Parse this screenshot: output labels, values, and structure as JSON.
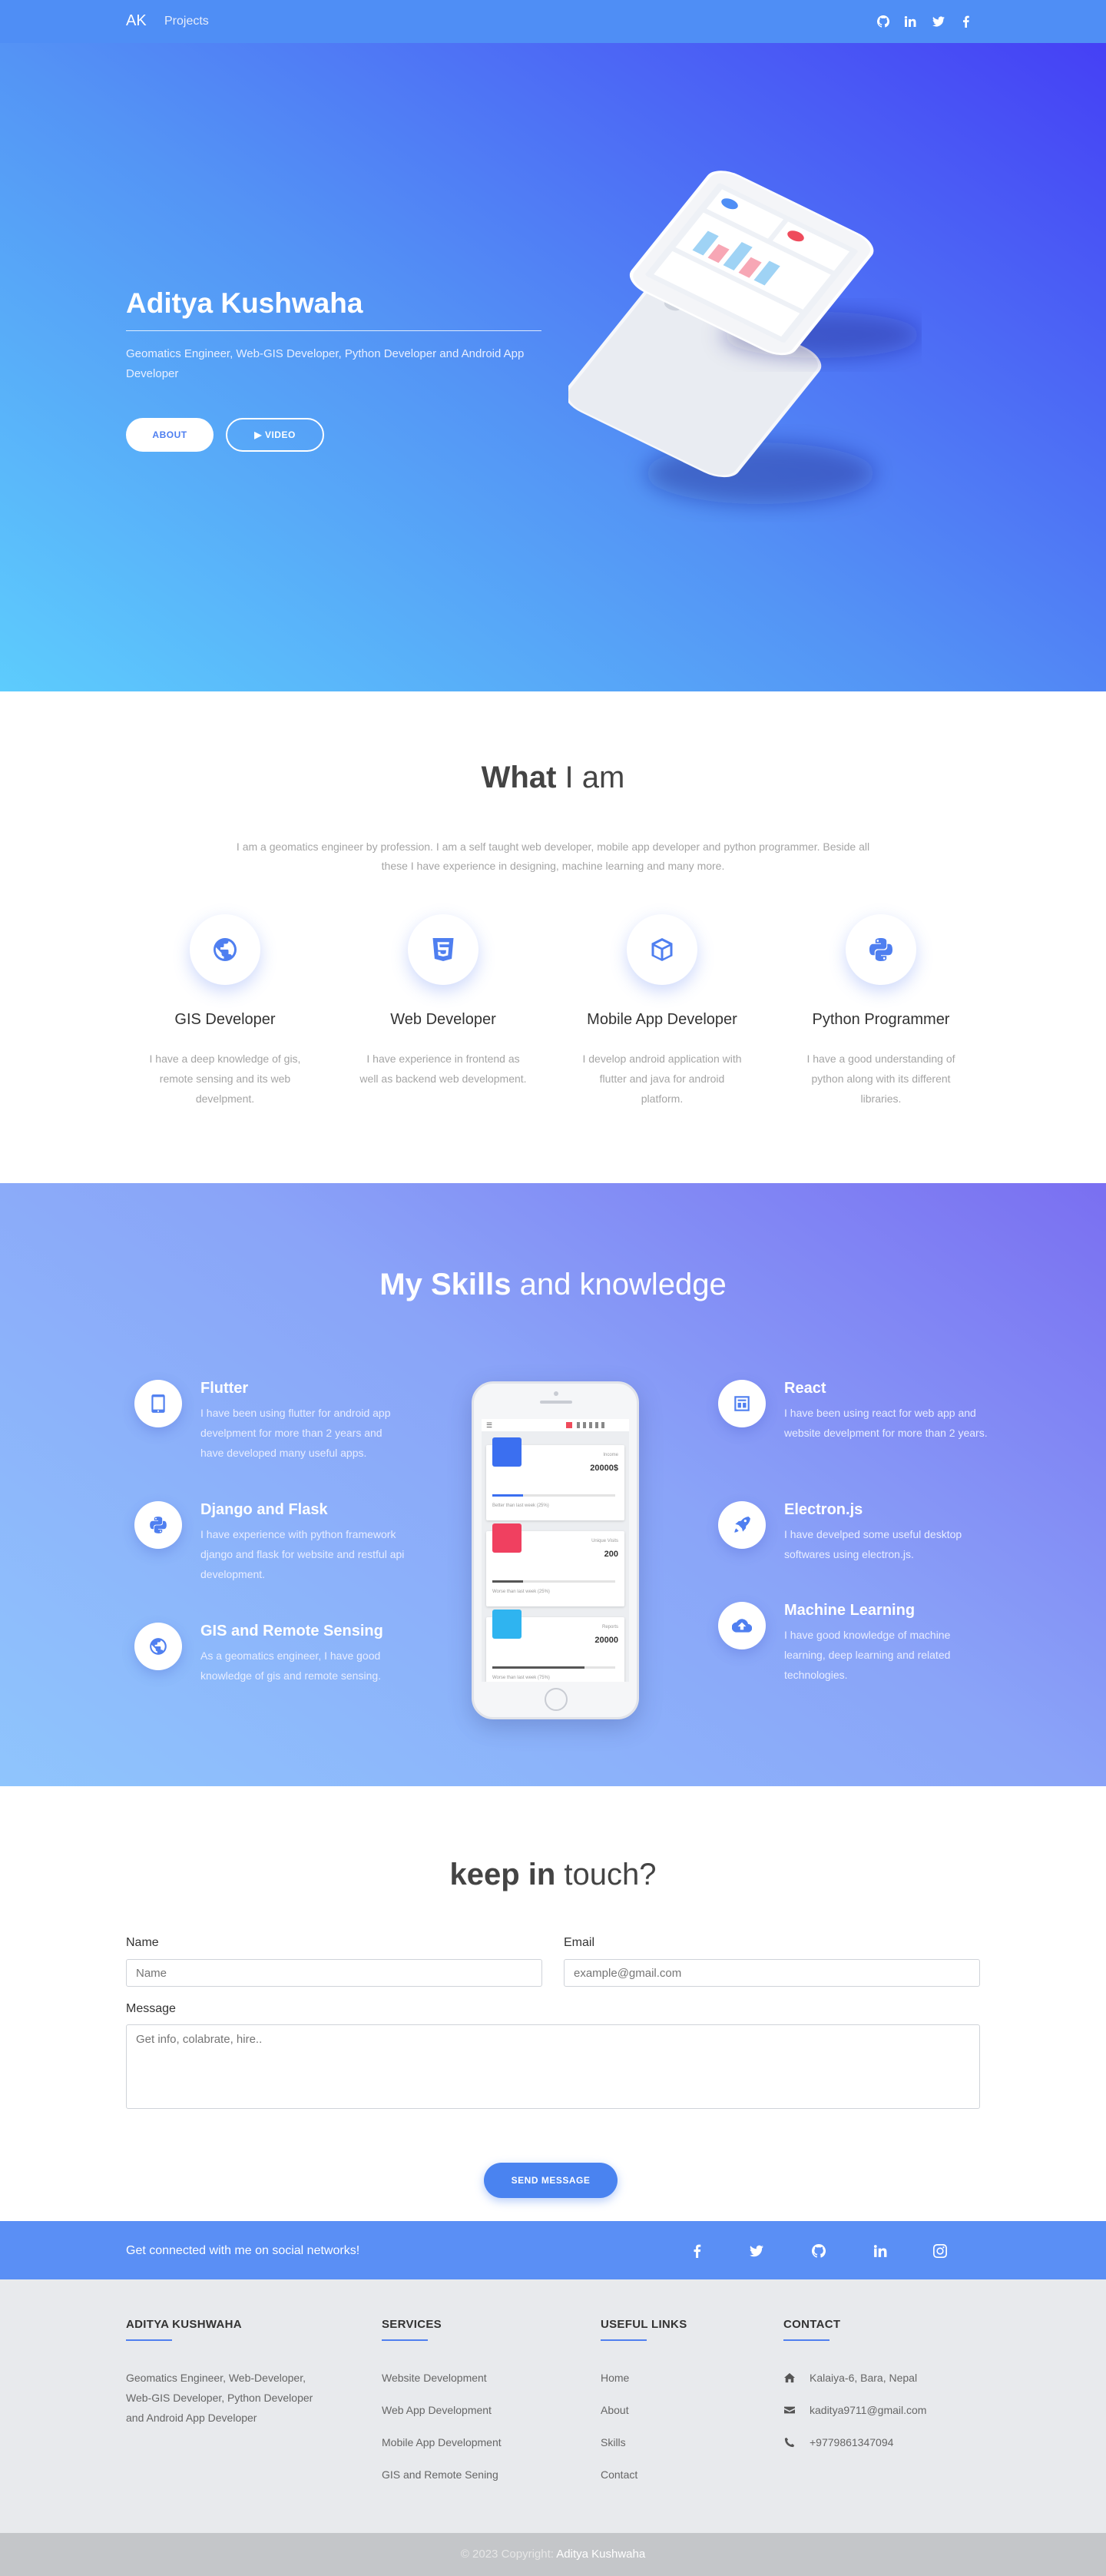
{
  "navbar": {
    "brand": "AK",
    "projects": "Projects"
  },
  "hero": {
    "title": "Aditya Kushwaha",
    "subtitle": "Geomatics Engineer, Web-GIS Developer, Python Developer and Android App Developer",
    "about_btn": "ABOUT",
    "video_btn": "VIDEO"
  },
  "what": {
    "title_bold": "What",
    "title_rest": " I am",
    "description": "I am a geomatics engineer by profession. I am a self taught web developer, mobile app developer and python programmer. Beside all these I have experience in designing, machine learning and many more.",
    "services": [
      {
        "title": "GIS Developer",
        "desc": "I have a deep knowledge of gis, remote sensing and its web develpment.",
        "icon": "globe-icon"
      },
      {
        "title": "Web Developer",
        "desc": "I have experience in frontend as well as backend web development.",
        "icon": "html5-icon"
      },
      {
        "title": "Mobile App Developer",
        "desc": "I develop android application with flutter and java for android platform.",
        "icon": "cube-icon"
      },
      {
        "title": "Python Programmer",
        "desc": "I have a good understanding of python along with its different libraries.",
        "icon": "python-icon"
      }
    ]
  },
  "skills": {
    "title_bold": "My Skills",
    "title_rest": " and knowledge",
    "left": [
      {
        "title": "Flutter",
        "desc": "I have been using flutter for android app develpment for more than 2 years and have developed many useful apps.",
        "icon": "tablet-icon"
      },
      {
        "title": "Django and Flask",
        "desc": "I have experience with python framework django and flask for website and restful api development.",
        "icon": "python-icon"
      },
      {
        "title": "GIS and Remote Sensing",
        "desc": "As a geomatics engineer, I have good knowledge of gis and remote sensing.",
        "icon": "globe-icon"
      }
    ],
    "right": [
      {
        "title": "React",
        "desc": "I have been using react for web app and website develpment for more than 2 years.",
        "icon": "react-icon"
      },
      {
        "title": "Electron.js",
        "desc": "I have develped some useful desktop softwares using electron.js.",
        "icon": "rocket-icon"
      },
      {
        "title": "Machine Learning",
        "desc": "I have good knowledge of machine learning, deep learning and related technologies.",
        "icon": "cloud-upload-icon"
      }
    ],
    "phone_cards": [
      {
        "label": "Income",
        "value": "20000$",
        "note": "Better than last week (25%)",
        "color": "#3b6ff0",
        "fill": 0.25
      },
      {
        "label": "Unique Visits",
        "value": "200",
        "note": "Worse than last week (25%)",
        "color": "#f04060",
        "fill": 0.25
      },
      {
        "label": "Reports",
        "value": "20000",
        "note": "Worse than last week (75%)",
        "color": "#2fb4f0",
        "fill": 0.75
      }
    ]
  },
  "contact": {
    "title_bold": "keep in",
    "title_rest": " touch?",
    "name_label": "Name",
    "name_placeholder": "Name",
    "email_label": "Email",
    "email_placeholder": "example@gmail.com",
    "message_label": "Message",
    "message_placeholder": "Get info, colabrate, hire..",
    "send_btn": "SEND MESSAGE"
  },
  "social": {
    "text": "Get connected with me on social networks!"
  },
  "footer": {
    "col1_title": "ADITYA KUSHWAHA",
    "col1_text": "Geomatics Engineer, Web-Developer, Web-GIS Developer, Python Developer and Android App Developer",
    "col2_title": "SERVICES",
    "services": [
      "Website Development",
      "Web App Development",
      "Mobile App Development",
      "GIS and Remote Sening"
    ],
    "col3_title": "USEFUL LINKS",
    "links": [
      "Home",
      "About",
      "Skills",
      "Contact"
    ],
    "col4_title": "CONTACT",
    "address": "Kalaiya-6, Bara, Nepal",
    "email": "kaditya9711@gmail.com",
    "phone": "+9779861347094"
  },
  "copyright": {
    "prefix": "© 2023 Copyright: ",
    "name": "Aditya Kushwaha"
  }
}
